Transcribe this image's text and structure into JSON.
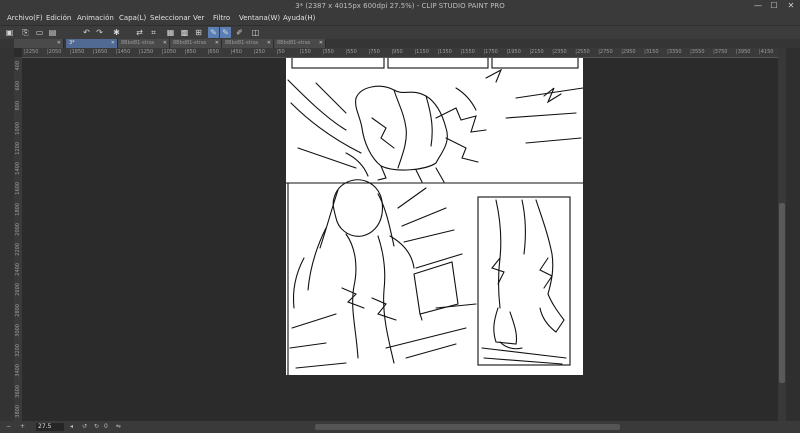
{
  "window": {
    "title": "3* (2387 x 4015px 600dpi 27.5%) - CLIP STUDIO PAINT PRO",
    "minimize": "—",
    "maximize": "☐",
    "close": "✕"
  },
  "menu": [
    "Archivo(F)",
    "Edición",
    "Animación",
    "Capa(L)",
    "Seleccionar",
    "Ver",
    "Filtro",
    "Ventana(W)",
    "Ayuda(H)"
  ],
  "toolbar": {
    "icons": [
      "new-icon",
      "new-file-icon",
      "open-icon",
      "save-icon",
      "undo-icon",
      "redo-icon",
      "loading-icon",
      "transform-icon",
      "snap-icon",
      "fill-icon",
      "grid-icon",
      "ruler-icon",
      "pen-icon",
      "pen-alt-icon",
      "brush-icon",
      "layer-icon"
    ],
    "glyphs": [
      "▣",
      "⎘",
      "▭",
      "▤",
      "↶",
      "↷",
      "✱",
      "⇄",
      "⌗",
      "▦",
      "▩",
      "⊞",
      "✎",
      "✎",
      "✐",
      "◫"
    ]
  },
  "tabs": [
    {
      "label": "3*",
      "active": true
    },
    {
      "label": "8Bbd81-stras",
      "active": false
    },
    {
      "label": "8Bbd81-stras",
      "active": false
    },
    {
      "label": "8Bbd81-stras",
      "active": false
    },
    {
      "label": "8Bbd81-stras",
      "active": false
    }
  ],
  "ruler_top": [
    "2250",
    "2050",
    "1850",
    "1650",
    "1450",
    "1250",
    "1050",
    "850",
    "650",
    "450",
    "250",
    "50",
    "150",
    "350",
    "550",
    "750",
    "950",
    "1150",
    "1350",
    "1550",
    "1750",
    "1950",
    "2150",
    "2350",
    "2550",
    "2750",
    "2950",
    "3150",
    "3350",
    "3550",
    "3750",
    "3950",
    "4150"
  ],
  "ruler_left": [
    "400",
    "600",
    "800",
    "1000",
    "1200",
    "1400",
    "1600",
    "1800",
    "2000",
    "2200",
    "2400",
    "2600",
    "2800",
    "3000",
    "3200",
    "3400",
    "3600",
    "3800"
  ],
  "status": {
    "zoom": "27.5",
    "angle": "0",
    "icons": [
      "minus-icon",
      "plus-icon",
      "fit-icon",
      "rotate-left-icon",
      "rotate-right-icon",
      "flip-icon"
    ]
  },
  "colors": {
    "accent": "#5b7fb5",
    "ui_bg": "#3a3a3a",
    "canvas_bg": "#2b2b2b",
    "page": "#ffffff"
  }
}
